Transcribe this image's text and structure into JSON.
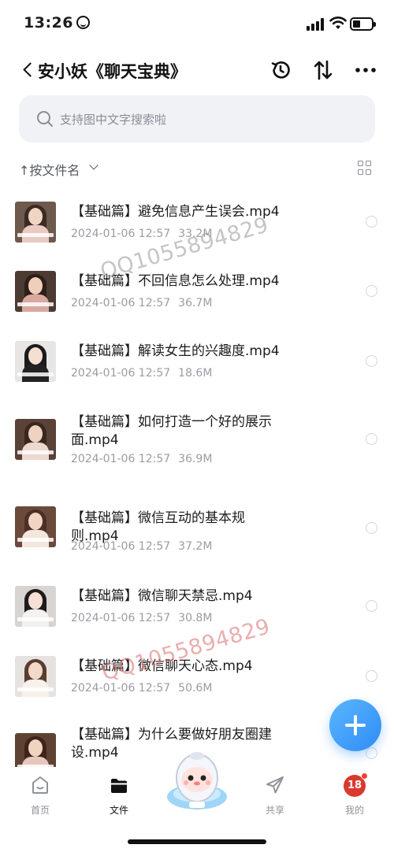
{
  "status_bar": {
    "time": "13:26"
  },
  "nav": {
    "title": "安小妖《聊天宝典》",
    "icons": [
      "back-icon",
      "history-icon",
      "sort-icon",
      "more-icon"
    ]
  },
  "search": {
    "placeholder": "支持图中文字搜索啦"
  },
  "sort": {
    "label": "↑按文件名"
  },
  "files": [
    {
      "name": "【基础篇】避免信息产生误会.mp4",
      "date": "2024-01-06 12:57",
      "size": "33.2M"
    },
    {
      "name": "【基础篇】不回信息怎么处理.mp4",
      "date": "2024-01-06 12:57",
      "size": "36.7M"
    },
    {
      "name": "【基础篇】解读女生的兴趣度.mp4",
      "date": "2024-01-06 12:57",
      "size": "18.6M"
    },
    {
      "name": "【基础篇】如何打造一个好的展示面.mp4",
      "date": "2024-01-06 12:57",
      "size": "36.9M"
    },
    {
      "name": "【基础篇】微信互动的基本规则.mp4",
      "date": "2024-01-06 12:57",
      "size": "37.2M"
    },
    {
      "name": "【基础篇】微信聊天禁忌.mp4",
      "date": "2024-01-06 12:57",
      "size": "30.8M"
    },
    {
      "name": "【基础篇】微信聊天心态.mp4",
      "date": "2024-01-06 12:57",
      "size": "50.6M"
    },
    {
      "name": "【基础篇】为什么要做好朋友圈建设.mp4",
      "date": "",
      "size": ""
    }
  ],
  "watermarks": [
    "QQ1055894829",
    "QQ1055894829"
  ],
  "tabs": [
    {
      "label": "首页",
      "icon": "home-icon"
    },
    {
      "label": "文件",
      "icon": "folder-icon",
      "active": true
    },
    {
      "label": "",
      "icon": "mascot-icon"
    },
    {
      "label": "共享",
      "icon": "share-icon"
    },
    {
      "label": "我的",
      "icon": "avatar-icon",
      "badge": "18"
    }
  ],
  "colors": {
    "accent": "#2f8cf5",
    "search_bg": "#f1f2f6",
    "meta_text": "#9a9ca3"
  }
}
